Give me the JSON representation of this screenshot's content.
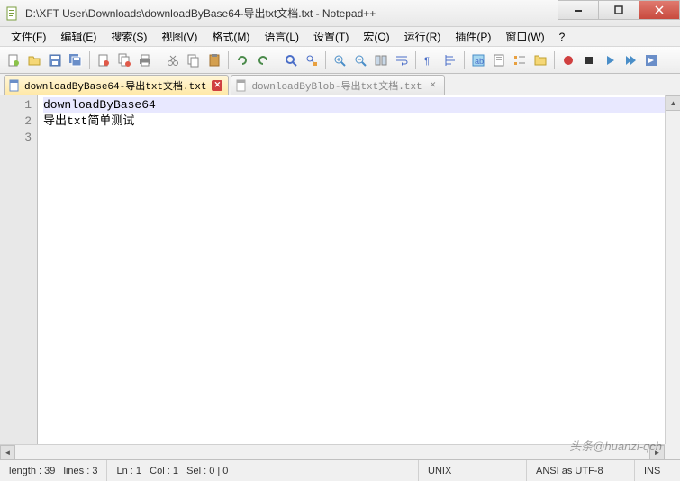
{
  "window": {
    "title": "D:\\XFT User\\Downloads\\downloadByBase64-导出txt文档.txt - Notepad++"
  },
  "menu": {
    "file": "文件(F)",
    "edit": "编辑(E)",
    "search": "搜索(S)",
    "view": "视图(V)",
    "format": "格式(M)",
    "language": "语言(L)",
    "settings": "设置(T)",
    "macro": "宏(O)",
    "run": "运行(R)",
    "plugins": "插件(P)",
    "window": "窗口(W)",
    "help": "?"
  },
  "tabs": [
    {
      "label": "downloadByBase64-导出txt文档.txt",
      "active": true
    },
    {
      "label": "downloadByBlob-导出txt文档.txt",
      "active": false
    }
  ],
  "editor": {
    "lines": [
      "downloadByBase64",
      "导出txt简单测试",
      ""
    ],
    "line_numbers": [
      "1",
      "2",
      "3"
    ]
  },
  "status": {
    "length_label": "length : 39",
    "lines_label": "lines : 3",
    "ln_label": "Ln : 1",
    "col_label": "Col : 1",
    "sel_label": "Sel : 0 | 0",
    "eol": "UNIX",
    "encoding": "ANSI as UTF-8",
    "mode": "INS"
  },
  "watermark": "头条@huanzi-qch"
}
